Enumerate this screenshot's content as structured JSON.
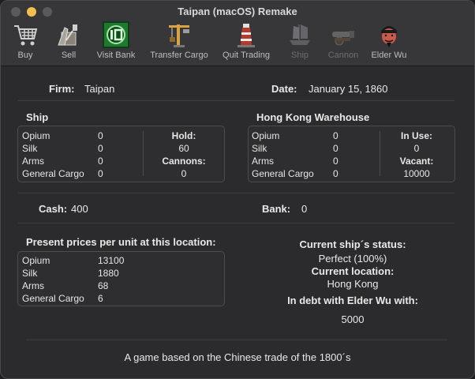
{
  "window": {
    "title": "Taipan (macOS) Remake"
  },
  "toolbar": [
    {
      "label": "Buy",
      "icon": "shopping-cart-icon",
      "enabled": true
    },
    {
      "label": "Sell",
      "icon": "sell-icon",
      "enabled": true
    },
    {
      "label": "Visit Bank",
      "icon": "bank-icon",
      "enabled": true
    },
    {
      "label": "Transfer Cargo",
      "icon": "crane-icon",
      "enabled": true
    },
    {
      "label": "Quit Trading",
      "icon": "lighthouse-icon",
      "enabled": true
    },
    {
      "label": "Ship",
      "icon": "junk-ship-icon",
      "enabled": false
    },
    {
      "label": "Cannon",
      "icon": "cannon-icon",
      "enabled": false
    },
    {
      "label": "Elder Wu",
      "icon": "elder-wu-face-icon",
      "enabled": true
    }
  ],
  "firm": {
    "label": "Firm:",
    "value": "Taipan"
  },
  "date": {
    "label": "Date:",
    "value": "January 15, 1860"
  },
  "ship": {
    "title": "Ship",
    "items": [
      {
        "name": "Opium",
        "qty": "0"
      },
      {
        "name": "Silk",
        "qty": "0"
      },
      {
        "name": "Arms",
        "qty": "0"
      },
      {
        "name": "General Cargo",
        "qty": "0"
      }
    ],
    "hold_label": "Hold:",
    "hold_value": "60",
    "cannons_label": "Cannons:",
    "cannons_value": "0"
  },
  "warehouse": {
    "title": "Hong Kong Warehouse",
    "items": [
      {
        "name": "Opium",
        "qty": "0"
      },
      {
        "name": "Silk",
        "qty": "0"
      },
      {
        "name": "Arms",
        "qty": "0"
      },
      {
        "name": "General Cargo",
        "qty": "0"
      }
    ],
    "inuse_label": "In Use:",
    "inuse_value": "0",
    "vacant_label": "Vacant:",
    "vacant_value": "10000"
  },
  "cash": {
    "label": "Cash:",
    "value": "400"
  },
  "bank": {
    "label": "Bank:",
    "value": "0"
  },
  "prices": {
    "title": "Present prices per unit at this location:",
    "items": [
      {
        "name": "Opium",
        "price": "13100"
      },
      {
        "name": "Silk",
        "price": "1880"
      },
      {
        "name": "Arms",
        "price": "68"
      },
      {
        "name": "General Cargo",
        "price": "6"
      }
    ]
  },
  "status": {
    "ship_status_label": "Current ship´s status:",
    "ship_status_value": "Perfect (100%)",
    "location_label": "Current location:",
    "location_value": "Hong Kong",
    "debt_label": "In debt with Elder Wu with:",
    "debt_value": "5000"
  },
  "footer": {
    "text": "A game based on the Chinese trade of the 1800´s"
  },
  "colors": {
    "background": "#2b2b2d",
    "titlebar": "#373739",
    "minimize": "#f5bf4f"
  }
}
